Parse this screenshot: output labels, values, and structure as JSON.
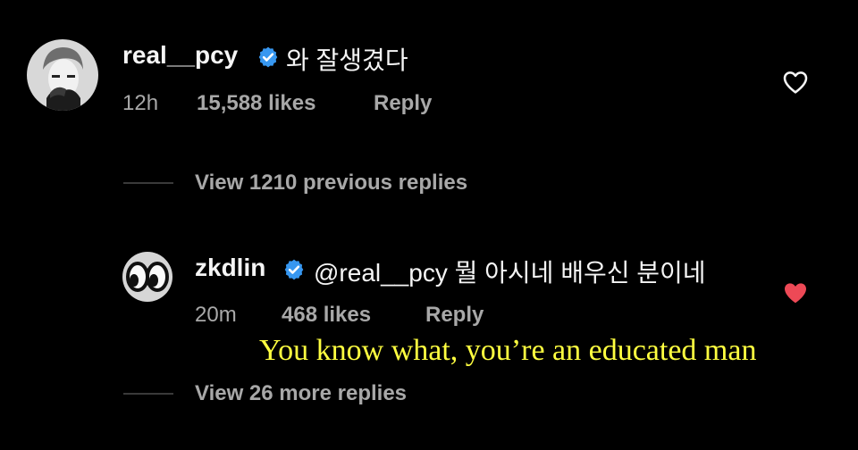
{
  "comment": {
    "username": "real__pcy",
    "text": "와 잘생겼다",
    "time": "12h",
    "likes": "15,588 likes",
    "reply_label": "Reply",
    "liked": false
  },
  "previous_replies": {
    "label": "View 1210 previous replies"
  },
  "reply": {
    "username": "zkdlin",
    "text": "@real__pcy 뭘 아시네 배우신 분이네",
    "time": "20m",
    "likes": "468 likes",
    "reply_label": "Reply",
    "liked": true
  },
  "more_replies": {
    "label": "View 26 more replies"
  },
  "caption": {
    "text": "You know what, you’re an educated man"
  },
  "colors": {
    "background": "#000000",
    "verified": "#3797f0",
    "liked_heart": "#ed4956",
    "caption": "#ffff40"
  }
}
